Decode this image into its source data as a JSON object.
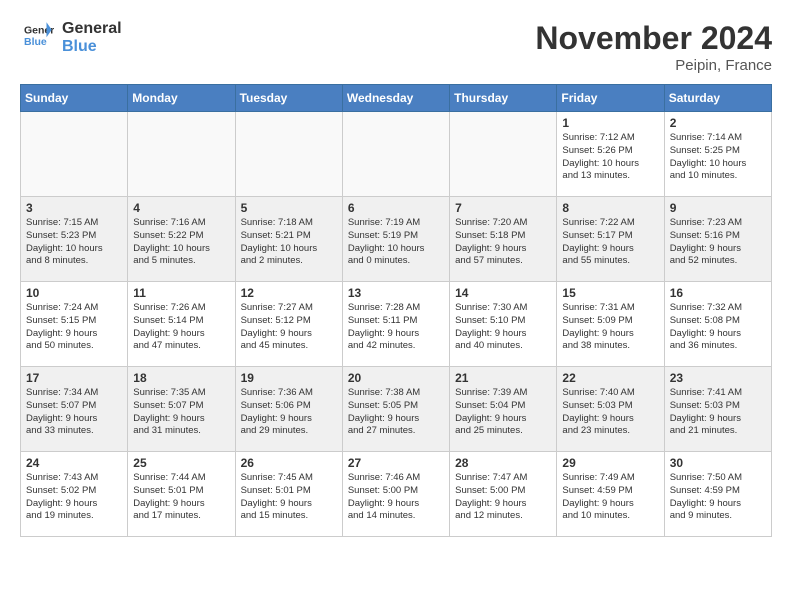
{
  "header": {
    "logo_line1": "General",
    "logo_line2": "Blue",
    "month": "November 2024",
    "location": "Peipin, France"
  },
  "weekdays": [
    "Sunday",
    "Monday",
    "Tuesday",
    "Wednesday",
    "Thursday",
    "Friday",
    "Saturday"
  ],
  "weeks": [
    [
      {
        "day": "",
        "info": ""
      },
      {
        "day": "",
        "info": ""
      },
      {
        "day": "",
        "info": ""
      },
      {
        "day": "",
        "info": ""
      },
      {
        "day": "",
        "info": ""
      },
      {
        "day": "1",
        "info": "Sunrise: 7:12 AM\nSunset: 5:26 PM\nDaylight: 10 hours\nand 13 minutes."
      },
      {
        "day": "2",
        "info": "Sunrise: 7:14 AM\nSunset: 5:25 PM\nDaylight: 10 hours\nand 10 minutes."
      }
    ],
    [
      {
        "day": "3",
        "info": "Sunrise: 7:15 AM\nSunset: 5:23 PM\nDaylight: 10 hours\nand 8 minutes."
      },
      {
        "day": "4",
        "info": "Sunrise: 7:16 AM\nSunset: 5:22 PM\nDaylight: 10 hours\nand 5 minutes."
      },
      {
        "day": "5",
        "info": "Sunrise: 7:18 AM\nSunset: 5:21 PM\nDaylight: 10 hours\nand 2 minutes."
      },
      {
        "day": "6",
        "info": "Sunrise: 7:19 AM\nSunset: 5:19 PM\nDaylight: 10 hours\nand 0 minutes."
      },
      {
        "day": "7",
        "info": "Sunrise: 7:20 AM\nSunset: 5:18 PM\nDaylight: 9 hours\nand 57 minutes."
      },
      {
        "day": "8",
        "info": "Sunrise: 7:22 AM\nSunset: 5:17 PM\nDaylight: 9 hours\nand 55 minutes."
      },
      {
        "day": "9",
        "info": "Sunrise: 7:23 AM\nSunset: 5:16 PM\nDaylight: 9 hours\nand 52 minutes."
      }
    ],
    [
      {
        "day": "10",
        "info": "Sunrise: 7:24 AM\nSunset: 5:15 PM\nDaylight: 9 hours\nand 50 minutes."
      },
      {
        "day": "11",
        "info": "Sunrise: 7:26 AM\nSunset: 5:14 PM\nDaylight: 9 hours\nand 47 minutes."
      },
      {
        "day": "12",
        "info": "Sunrise: 7:27 AM\nSunset: 5:12 PM\nDaylight: 9 hours\nand 45 minutes."
      },
      {
        "day": "13",
        "info": "Sunrise: 7:28 AM\nSunset: 5:11 PM\nDaylight: 9 hours\nand 42 minutes."
      },
      {
        "day": "14",
        "info": "Sunrise: 7:30 AM\nSunset: 5:10 PM\nDaylight: 9 hours\nand 40 minutes."
      },
      {
        "day": "15",
        "info": "Sunrise: 7:31 AM\nSunset: 5:09 PM\nDaylight: 9 hours\nand 38 minutes."
      },
      {
        "day": "16",
        "info": "Sunrise: 7:32 AM\nSunset: 5:08 PM\nDaylight: 9 hours\nand 36 minutes."
      }
    ],
    [
      {
        "day": "17",
        "info": "Sunrise: 7:34 AM\nSunset: 5:07 PM\nDaylight: 9 hours\nand 33 minutes."
      },
      {
        "day": "18",
        "info": "Sunrise: 7:35 AM\nSunset: 5:07 PM\nDaylight: 9 hours\nand 31 minutes."
      },
      {
        "day": "19",
        "info": "Sunrise: 7:36 AM\nSunset: 5:06 PM\nDaylight: 9 hours\nand 29 minutes."
      },
      {
        "day": "20",
        "info": "Sunrise: 7:38 AM\nSunset: 5:05 PM\nDaylight: 9 hours\nand 27 minutes."
      },
      {
        "day": "21",
        "info": "Sunrise: 7:39 AM\nSunset: 5:04 PM\nDaylight: 9 hours\nand 25 minutes."
      },
      {
        "day": "22",
        "info": "Sunrise: 7:40 AM\nSunset: 5:03 PM\nDaylight: 9 hours\nand 23 minutes."
      },
      {
        "day": "23",
        "info": "Sunrise: 7:41 AM\nSunset: 5:03 PM\nDaylight: 9 hours\nand 21 minutes."
      }
    ],
    [
      {
        "day": "24",
        "info": "Sunrise: 7:43 AM\nSunset: 5:02 PM\nDaylight: 9 hours\nand 19 minutes."
      },
      {
        "day": "25",
        "info": "Sunrise: 7:44 AM\nSunset: 5:01 PM\nDaylight: 9 hours\nand 17 minutes."
      },
      {
        "day": "26",
        "info": "Sunrise: 7:45 AM\nSunset: 5:01 PM\nDaylight: 9 hours\nand 15 minutes."
      },
      {
        "day": "27",
        "info": "Sunrise: 7:46 AM\nSunset: 5:00 PM\nDaylight: 9 hours\nand 14 minutes."
      },
      {
        "day": "28",
        "info": "Sunrise: 7:47 AM\nSunset: 5:00 PM\nDaylight: 9 hours\nand 12 minutes."
      },
      {
        "day": "29",
        "info": "Sunrise: 7:49 AM\nSunset: 4:59 PM\nDaylight: 9 hours\nand 10 minutes."
      },
      {
        "day": "30",
        "info": "Sunrise: 7:50 AM\nSunset: 4:59 PM\nDaylight: 9 hours\nand 9 minutes."
      }
    ]
  ]
}
